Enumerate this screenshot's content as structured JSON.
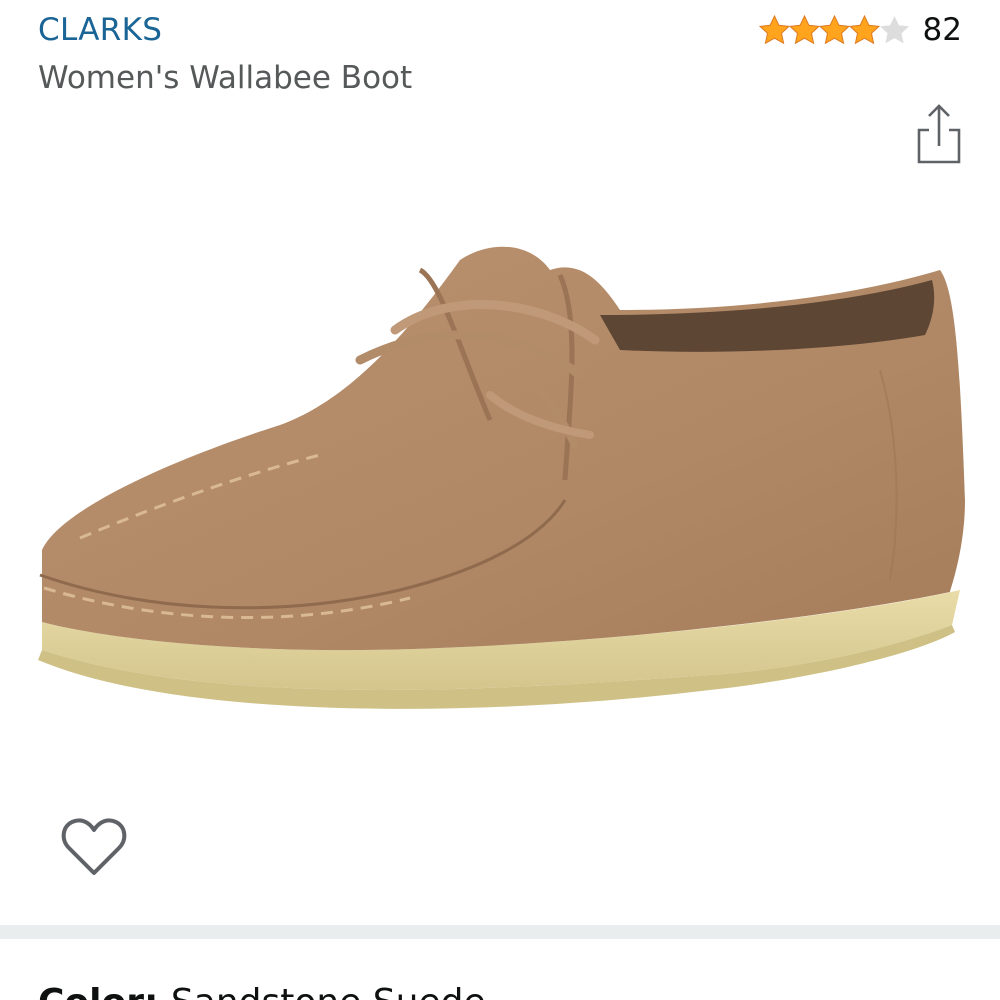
{
  "header": {
    "brand": "CLARKS",
    "title": "Women's Wallabee Boot"
  },
  "rating": {
    "stars": 4,
    "max_stars": 5,
    "review_count": "82",
    "star_color": "#ffa41c",
    "empty_star_color": "#dddddd"
  },
  "icons": {
    "share": "share-icon",
    "wishlist": "heart-outline-icon"
  },
  "product_image": {
    "subject": "shoe-image",
    "suede_color": "#b08866",
    "sole_color": "#e0d49c"
  },
  "variation": {
    "label": "Color:",
    "value": "Sandstone Suede"
  }
}
